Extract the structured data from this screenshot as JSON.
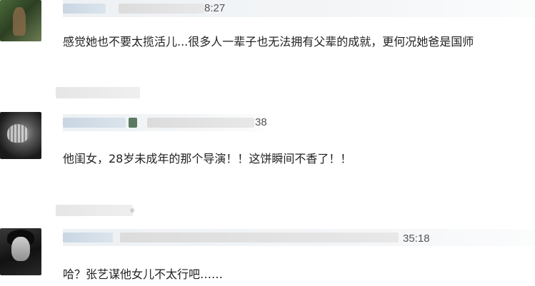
{
  "comments": [
    {
      "time": "8:27",
      "text": "感觉她也不要太揽活儿...很多人一辈子也无法拥有父辈的成就，更何况她爸是国师"
    },
    {
      "time": "38",
      "text": "他闺女，28岁未成年的那个导演！！这饼瞬间不香了！！"
    },
    {
      "time": "35:18",
      "text": "哈？张艺谋他女儿不太行吧……"
    }
  ]
}
